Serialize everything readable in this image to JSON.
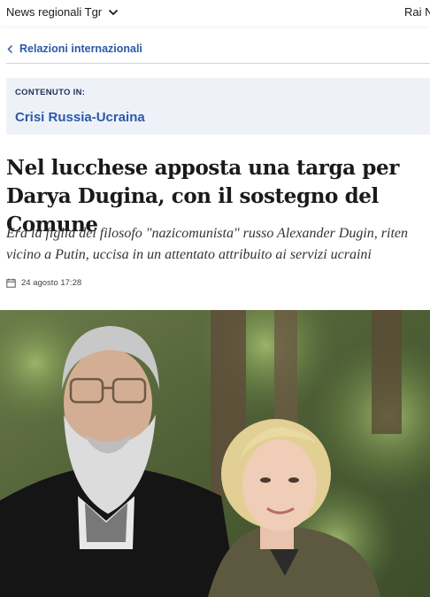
{
  "topbar": {
    "section_label": "News regionali Tgr",
    "right_label": "Rai Ne"
  },
  "breadcrumb": {
    "label": "Relazioni internazionali"
  },
  "content_box": {
    "label": "CONTENUTO IN:",
    "topic": "Crisi Russia-Ucraina"
  },
  "article": {
    "headline": "Nel lucchese apposta una targa per Darya Dugina, con il sostegno del Comune",
    "subtitle_line1": "Era la figlia del filosofo \"nazicomunista\" russo Alexander Dugin, riten",
    "subtitle_line2": "vicino a Putin, uccisa in un attentato attribuito ai servizi ucraini",
    "date": "24 agosto 17:28"
  },
  "icons": {
    "topbar_chevron": "chevron-down-icon",
    "breadcrumb_back": "chevron-left-icon",
    "date": "calendar-icon"
  },
  "colors": {
    "accent_blue": "#2b5aa8",
    "label_navy": "#1f2f5a",
    "box_bg": "#eef2f8"
  }
}
